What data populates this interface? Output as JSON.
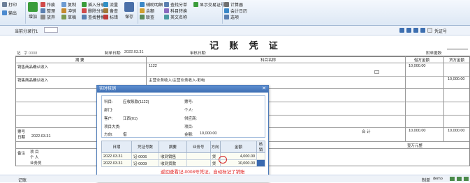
{
  "ribbon": {
    "left_items": [
      {
        "label": "打印",
        "icon": "printer-icon"
      },
      {
        "label": "输出",
        "icon": "export-icon"
      }
    ],
    "big_buttons": [
      {
        "label": "增加",
        "icon": "add-icon"
      }
    ],
    "group1": [
      {
        "label": "作废",
        "icon": "void-icon"
      },
      {
        "label": "整理",
        "icon": "arrange-icon"
      },
      {
        "label": "放弃",
        "icon": "discard-icon"
      }
    ],
    "group1b": [
      {
        "label": "复制",
        "icon": "copy-icon"
      },
      {
        "label": "冲销",
        "icon": "reverse-icon"
      },
      {
        "label": "草稿",
        "icon": "draft-icon"
      }
    ],
    "group2": [
      {
        "label": "插入分录",
        "icon": "insert-entry-icon"
      },
      {
        "label": "删除分录",
        "icon": "delete-entry-icon"
      },
      {
        "label": "查找替换",
        "icon": "find-replace-icon"
      }
    ],
    "group3": [
      {
        "label": "流量",
        "icon": "flow-icon"
      },
      {
        "label": "备查",
        "icon": "memo-icon"
      },
      {
        "label": "标错",
        "icon": "mark-error-icon"
      }
    ],
    "save_label": "保存",
    "group4": [
      {
        "label": "辅助明细",
        "icon": "aux-detail-icon"
      },
      {
        "label": "余额",
        "icon": "balance-icon"
      },
      {
        "label": "联查",
        "icon": "linked-query-icon"
      }
    ],
    "group5": [
      {
        "label": "查找分单",
        "icon": "find-split-icon"
      },
      {
        "label": "科目转换",
        "icon": "account-convert-icon"
      },
      {
        "label": "英文名称",
        "icon": "english-name-icon"
      }
    ],
    "group6": [
      {
        "label": "显示交易证号",
        "icon": "show-txn-icon"
      }
    ],
    "group7": [
      {
        "label": "计算器",
        "icon": "calculator-icon"
      },
      {
        "label": "会计日历",
        "icon": "calendar-icon"
      },
      {
        "label": "选项",
        "icon": "options-icon"
      }
    ]
  },
  "toolbar": {
    "entry_label": "当前分录行1",
    "voucher_no_label": "凭证号"
  },
  "voucher": {
    "title": "记 账 凭 证",
    "word_label": "记",
    "word_value": "字 0008",
    "date_label": "制单日期:",
    "date_value": "2022.03.31",
    "audit_date_label": "审核日期:",
    "attach_label": "附单据数:",
    "col_summary": "摘 要",
    "col_account": "科目名称",
    "col_debit": "借方金额",
    "col_credit": "贷方金额",
    "row1_summary": "销售商品确认收入",
    "row1_account": "1122",
    "row1_debit": "10,000.00",
    "row2_summary": "销售商品确认收入",
    "row2_account": "主营业务收入/主营业务收入-彩电",
    "row2_credit": "10,000.00",
    "bill_no_label": "票号",
    "bill_date_label": "日期",
    "bill_date_value": "2022.03.31",
    "total_label": "合 计",
    "total_debit": "10,000.00",
    "total_credit": "10,000.00",
    "amount_words": "壹万元整",
    "note_label": "备注",
    "project_label": "项 目",
    "person_label": "个 人",
    "salesman_label": "业务员",
    "bookkeeper_label": "记账",
    "maker_label": "制单",
    "maker_value": "demo"
  },
  "dialog": {
    "title": "实时核销",
    "fields": {
      "account_label": "科目:",
      "account_value": "应收账款(1122)",
      "bill_no_label": "票号:",
      "dept_label": "部门:",
      "person_label": "个人:",
      "customer_label": "客户:",
      "customer_value": "江西(01)",
      "supplier_label": "供应商:",
      "project_class_label": "项目大类:",
      "project_label": "项目:",
      "direction_label": "方向:",
      "direction_value": "借",
      "amount_label": "金额:",
      "amount_value": "10,000.00"
    },
    "table_headers": [
      "日期",
      "凭证号数",
      "摘要",
      "业务号",
      "方向",
      "金额",
      "核销"
    ],
    "rows": [
      {
        "date": "2022.03.31",
        "voucher": "记-0006",
        "summary": "收到销售",
        "biz": "",
        "dir": "贷",
        "amount": "4,000.00"
      },
      {
        "date": "2022.03.31",
        "voucher": "记-0009",
        "summary": "收到货款",
        "biz": "",
        "dir": "贷",
        "amount": "10,000.00"
      }
    ]
  },
  "annotation": "返回查看记-0008号凭证，自动标记了销账",
  "colors": {
    "ribbon_bg": "#dde8f5",
    "dialog_title": "#3c6db2",
    "annotation": "#e02020"
  }
}
